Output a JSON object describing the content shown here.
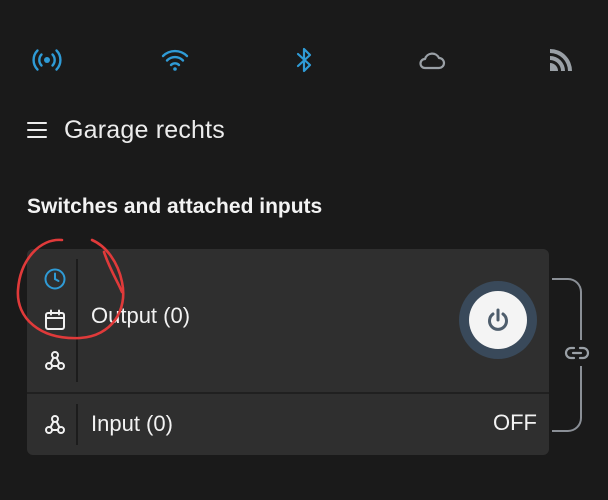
{
  "app": {
    "title": "Garage rechts",
    "section_title": "Switches and attached inputs"
  },
  "status_icons": [
    "broadcast-icon",
    "wifi-icon",
    "bluetooth-icon",
    "cloud-icon",
    "rss-icon"
  ],
  "colors": {
    "accent": "#2f9bd6",
    "icon_muted": "#9aa0a6",
    "annotation": "#e03a3a",
    "power_ring": "#39495a"
  },
  "output": {
    "label": "Output (0)",
    "icons": [
      "clock-icon",
      "calendar-icon",
      "webhook-icon"
    ]
  },
  "input": {
    "label": "Input (0)",
    "state": "OFF",
    "icons": [
      "webhook-icon"
    ]
  }
}
